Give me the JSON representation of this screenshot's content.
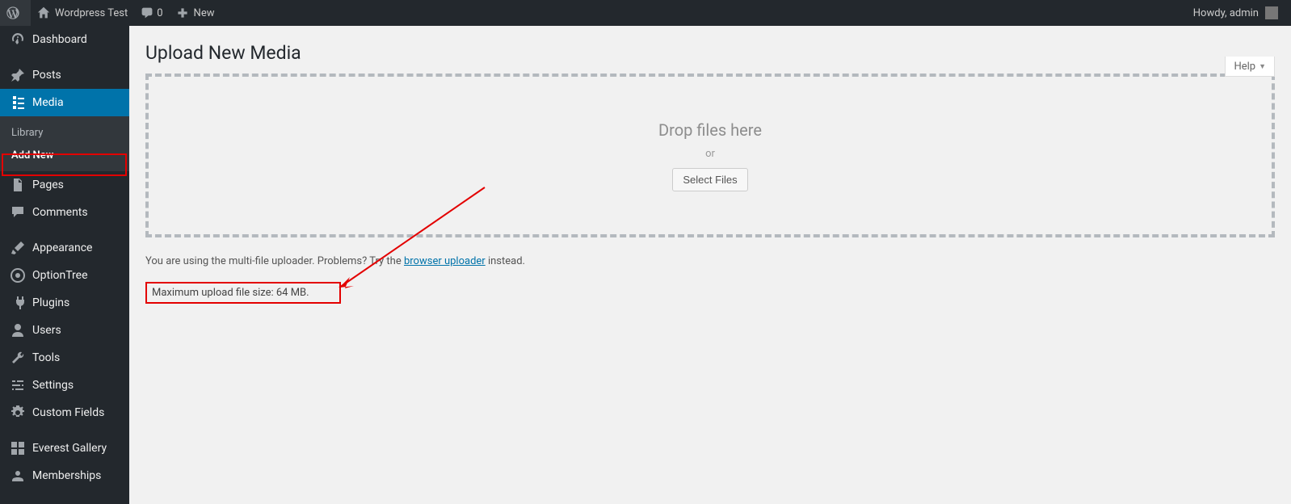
{
  "adminbar": {
    "site_title": "Wordpress Test",
    "comment_count": "0",
    "new_label": "New",
    "greeting": "Howdy,",
    "username": "admin"
  },
  "sidebar": {
    "dashboard": "Dashboard",
    "posts": "Posts",
    "media": "Media",
    "media_submenu": {
      "library": "Library",
      "add_new": "Add New"
    },
    "pages": "Pages",
    "comments": "Comments",
    "appearance": "Appearance",
    "optiontree": "OptionTree",
    "plugins": "Plugins",
    "users": "Users",
    "tools": "Tools",
    "settings": "Settings",
    "custom_fields": "Custom Fields",
    "everest_gallery": "Everest Gallery",
    "memberships": "Memberships"
  },
  "help_label": "Help",
  "page": {
    "title": "Upload New Media",
    "drop_text": "Drop files here",
    "or_text": "or",
    "select_button": "Select Files",
    "multi_uploader_msg_pre": "You are using the multi-file uploader. Problems? Try the ",
    "multi_uploader_link": "browser uploader",
    "multi_uploader_msg_post": " instead.",
    "max_size": "Maximum upload file size: 64 MB."
  }
}
